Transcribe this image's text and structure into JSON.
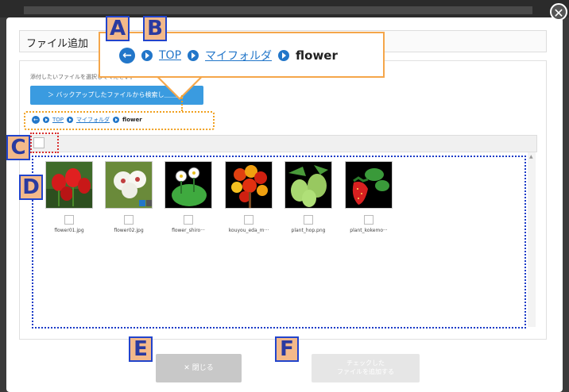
{
  "modal": {
    "title": "ファイル追加",
    "close_glyph": "✕",
    "instruction": "添付したいファイルを選択してください。",
    "backup_button": "＞ バックアップしたファイルから検索し＿＿＿"
  },
  "breadcrumb": {
    "back_glyph": "←",
    "items": [
      "TOP",
      "マイフォルダ"
    ],
    "current": "flower"
  },
  "markers": [
    "A",
    "B",
    "C",
    "D",
    "E",
    "F"
  ],
  "files": [
    {
      "name": "flower01.jpg",
      "icon": "red-tulips-photo"
    },
    {
      "name": "flower02.jpg",
      "icon": "white-flowers-photo"
    },
    {
      "name": "flower_shiro···",
      "icon": "white-flowers-illustration"
    },
    {
      "name": "kouyou_eda_m···",
      "icon": "autumn-leaves-illustration"
    },
    {
      "name": "plant_hop.png",
      "icon": "hop-plant-illustration"
    },
    {
      "name": "plant_kokemo···",
      "icon": "strawberry-plant-illustration"
    }
  ],
  "footer": {
    "close_label": "✕ 閉じる",
    "add_line1": "チェックした",
    "add_line2": "ファイルを追加する"
  },
  "colors": {
    "accent": "#2276c9",
    "callout_border": "#f5a64a",
    "marker_fill": "#f3b98a",
    "marker_border": "#2244cc"
  }
}
